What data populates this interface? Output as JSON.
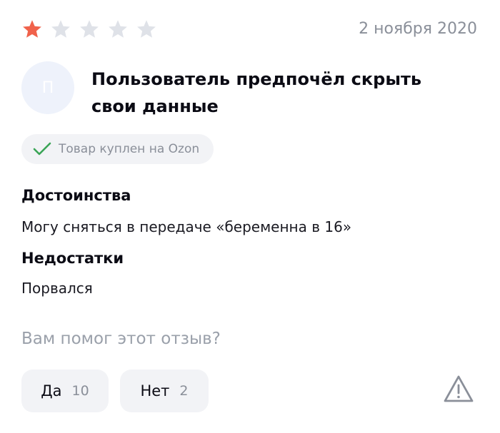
{
  "review": {
    "rating": 1,
    "max_rating": 5,
    "date": "2 ноября 2020",
    "avatar_letter": "П",
    "author": "Пользователь предпочёл скрыть свои данные",
    "purchase_badge": "Товар куплен на Ozon",
    "pros_title": "Достоинства",
    "pros_text": "Могу сняться в передаче «беременна в 16»",
    "cons_title": "Недостатки",
    "cons_text": "Порвался"
  },
  "helpful": {
    "question": "Вам помог этот отзыв?",
    "yes_label": "Да",
    "yes_count": "10",
    "no_label": "Нет",
    "no_count": "2"
  },
  "colors": {
    "star_filled": "#f0624b",
    "star_empty": "#dfe2e8",
    "check": "#3aa556",
    "muted": "#8a8f99"
  },
  "icons": {
    "star": "star-icon",
    "check": "checkmark-icon",
    "report": "warning-triangle-icon"
  }
}
